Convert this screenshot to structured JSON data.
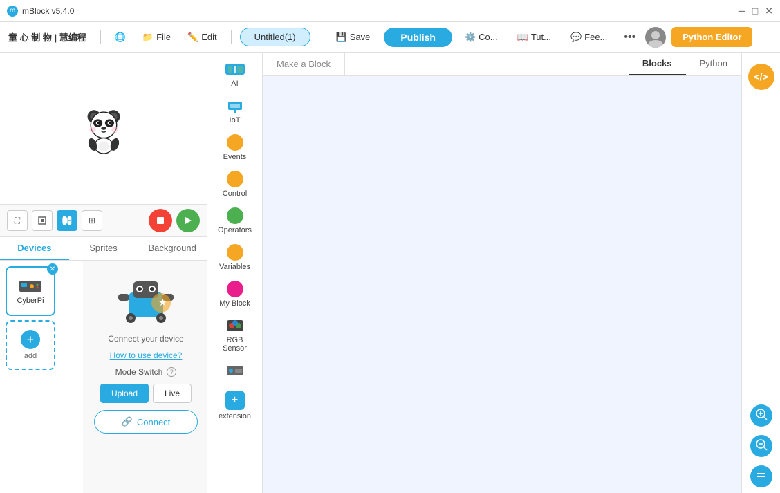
{
  "titlebar": {
    "app_name": "mBlock v5.4.0",
    "controls": [
      "minimize",
      "maximize",
      "close"
    ]
  },
  "menubar": {
    "brand": "童 心 制 物 | 慧编程",
    "globe_icon": "🌐",
    "file_label": "File",
    "edit_label": "Edit",
    "project_name": "Untitled(1)",
    "save_label": "Save",
    "publish_label": "Publish",
    "co_label": "Co...",
    "tut_label": "Tut...",
    "fee_label": "Fee...",
    "more_icon": "•••",
    "python_editor_label": "Python Editor"
  },
  "workspace_tabs": {
    "make_a_block": "Make a Block"
  },
  "blocks_python_tabs": [
    {
      "id": "blocks",
      "label": "Blocks",
      "active": true
    },
    {
      "id": "python",
      "label": "Python",
      "active": false
    }
  ],
  "categories": [
    {
      "id": "ai",
      "label": "AI",
      "type": "icon",
      "color": "#4db6ac"
    },
    {
      "id": "iot",
      "label": "IoT",
      "type": "icon",
      "color": "#29abe2"
    },
    {
      "id": "events",
      "label": "Events",
      "type": "dot",
      "color": "#f5a623"
    },
    {
      "id": "control",
      "label": "Control",
      "type": "dot",
      "color": "#f5a623"
    },
    {
      "id": "operators",
      "label": "Operators",
      "type": "dot",
      "color": "#4caf50"
    },
    {
      "id": "variables",
      "label": "Variables",
      "type": "dot",
      "color": "#f5a623"
    },
    {
      "id": "my_block",
      "label": "My Block",
      "type": "dot",
      "color": "#e91e8c"
    },
    {
      "id": "rgb_sensor",
      "label": "RGB\nSensor",
      "type": "icon",
      "color": "#29abe2"
    },
    {
      "id": "extra",
      "label": "",
      "type": "icon2",
      "color": "#29abe2"
    },
    {
      "id": "extension",
      "label": "extension",
      "type": "add",
      "color": "#29abe2"
    }
  ],
  "stage_controls": [
    {
      "id": "fit",
      "icon": "⛶",
      "active": false
    },
    {
      "id": "small",
      "icon": "▪",
      "active": false
    },
    {
      "id": "medium",
      "icon": "◼",
      "active": true
    },
    {
      "id": "large",
      "icon": "⊞",
      "active": false
    }
  ],
  "tabs": [
    {
      "id": "devices",
      "label": "Devices",
      "active": true
    },
    {
      "id": "sprites",
      "label": "Sprites",
      "active": false
    },
    {
      "id": "background",
      "label": "Background",
      "active": false
    }
  ],
  "device": {
    "name": "CyberPi",
    "connect_text": "Connect your device",
    "how_to_use": "How to use device?",
    "mode_switch_label": "Mode Switch",
    "upload_label": "Upload",
    "live_label": "Live",
    "connect_btn_label": "Connect",
    "add_label": "add"
  },
  "right_panel": {
    "code_icon": "</>",
    "zoom_in_icon": "+",
    "zoom_out_icon": "−",
    "equal_icon": "="
  }
}
